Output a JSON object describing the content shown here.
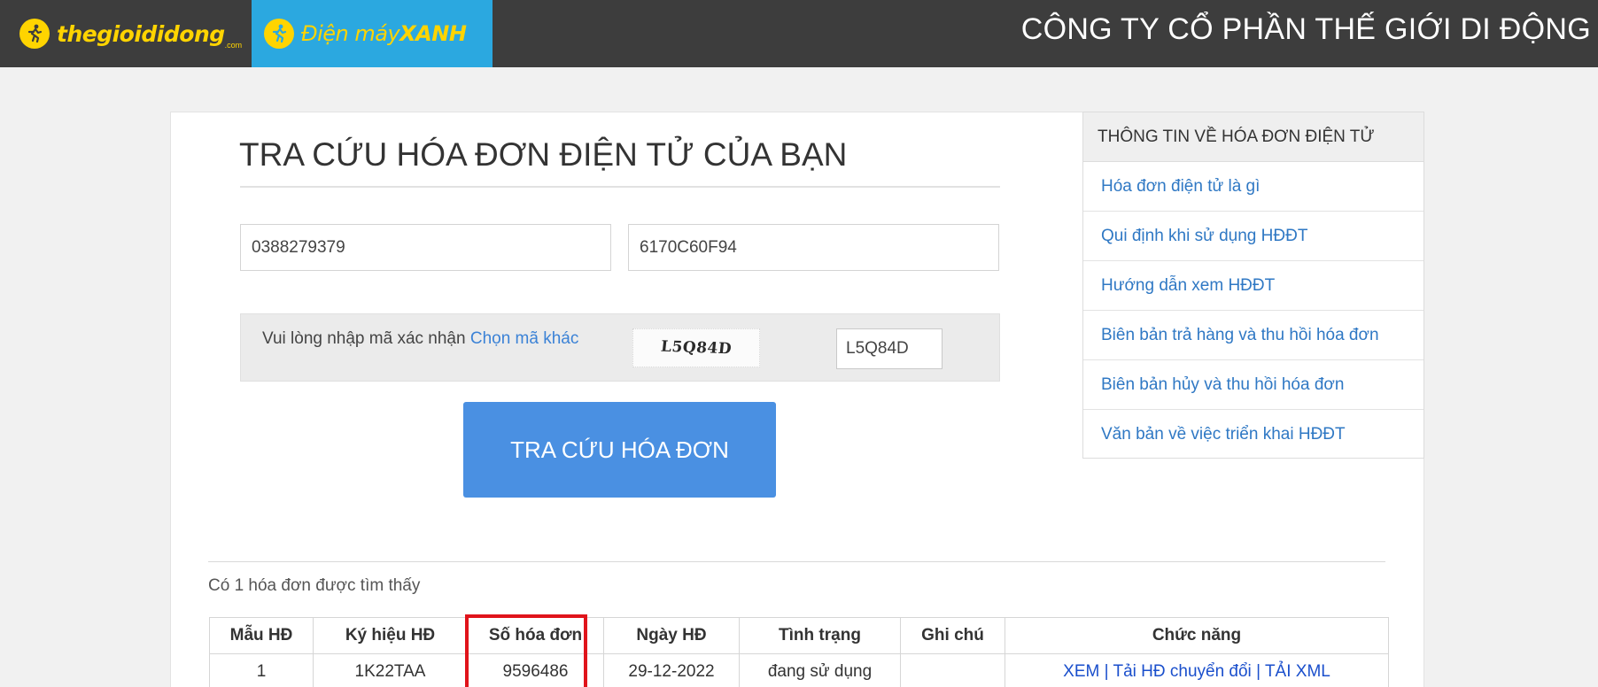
{
  "header": {
    "brand_tgdd": "thegioididong",
    "brand_tgdd_sub": ".com",
    "brand_dmx_regular": "Điện máy",
    "brand_dmx_bold": "XANH",
    "company": "CÔNG TY CỔ PHẦN THẾ GIỚI DI ĐỘNG",
    "colors": {
      "bar": "#3d3d3d",
      "dmx": "#2ba8e0",
      "logo_yellow": "#ffd400"
    }
  },
  "lookup": {
    "title": "TRA CỨU HÓA ĐƠN ĐIỆN TỬ CỦA BẠN",
    "phone_value": "0388279379",
    "code_value": "6170C60F94",
    "captcha_prompt": "Vui lòng nhập mã xác nhận",
    "captcha_change_link": "Chọn mã khác",
    "captcha_image_text": "L5Q84D",
    "captcha_value": "L5Q84D",
    "submit_label": "TRA CỨU HÓA ĐƠN",
    "colors": {
      "button": "#4a90e2",
      "link": "#3b82d6"
    }
  },
  "sidebar": {
    "heading": "THÔNG TIN VỀ HÓA ĐƠN ĐIỆN TỬ",
    "items": [
      {
        "label": "Hóa đơn điện tử là gì"
      },
      {
        "label": "Qui định khi sử dụng HĐĐT"
      },
      {
        "label": "Hướng dẫn xem HĐĐT"
      },
      {
        "label": "Biên bản trả hàng và thu hồi hóa đơn"
      },
      {
        "label": "Biên bản hủy và thu hồi hóa đơn"
      },
      {
        "label": "Văn bản về việc triển khai HĐĐT"
      }
    ]
  },
  "results": {
    "found_text": "Có 1 hóa đơn được tìm thấy",
    "columns": [
      "Mẫu HĐ",
      "Ký hiệu HĐ",
      "Số hóa đơn",
      "Ngày HĐ",
      "Tình trạng",
      "Ghi chú",
      "Chức năng"
    ],
    "rows": [
      {
        "mau_hd": "1",
        "ky_hieu": "1K22TAA",
        "so_hoa_don": "9596486",
        "ngay": "29-12-2022",
        "tinh_trang": "đang sử dụng",
        "ghi_chu": "",
        "actions": {
          "view": "XEM",
          "convert": "Tải HĐ chuyển đổi",
          "xml": "TẢI XML",
          "separator": "|"
        }
      }
    ],
    "highlight_color": "#e0141b"
  }
}
